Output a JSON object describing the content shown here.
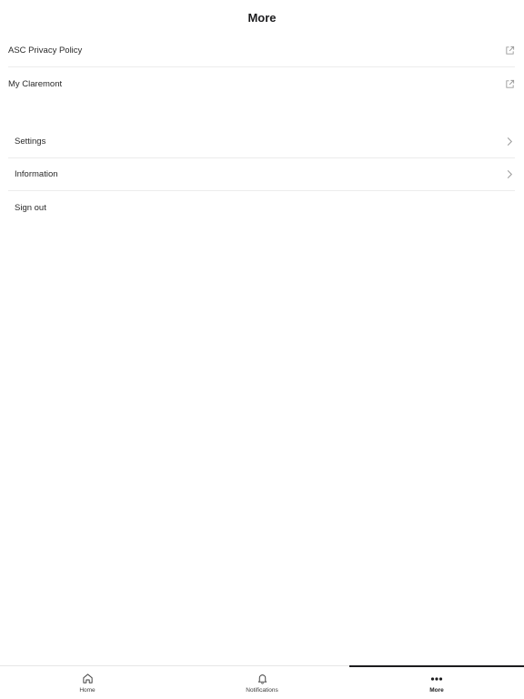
{
  "header": {
    "title": "More"
  },
  "links": [
    {
      "label": "ASC Privacy Policy",
      "icon": "external-link-icon"
    },
    {
      "label": "My Claremont",
      "icon": "external-link-icon"
    }
  ],
  "menu": [
    {
      "label": "Settings",
      "icon": "chevron-right-icon"
    },
    {
      "label": "Information",
      "icon": "chevron-right-icon"
    },
    {
      "label": "Sign out"
    }
  ],
  "tabbar": {
    "tabs": [
      {
        "label": "Home",
        "icon": "home-icon",
        "active": false
      },
      {
        "label": "Notifications",
        "icon": "bell-icon",
        "active": false
      },
      {
        "label": "More",
        "icon": "more-dots-icon",
        "active": true
      }
    ]
  },
  "colors": {
    "text": "#1c1c1e",
    "divider": "#ececec",
    "icon": "#9a9a9a"
  }
}
